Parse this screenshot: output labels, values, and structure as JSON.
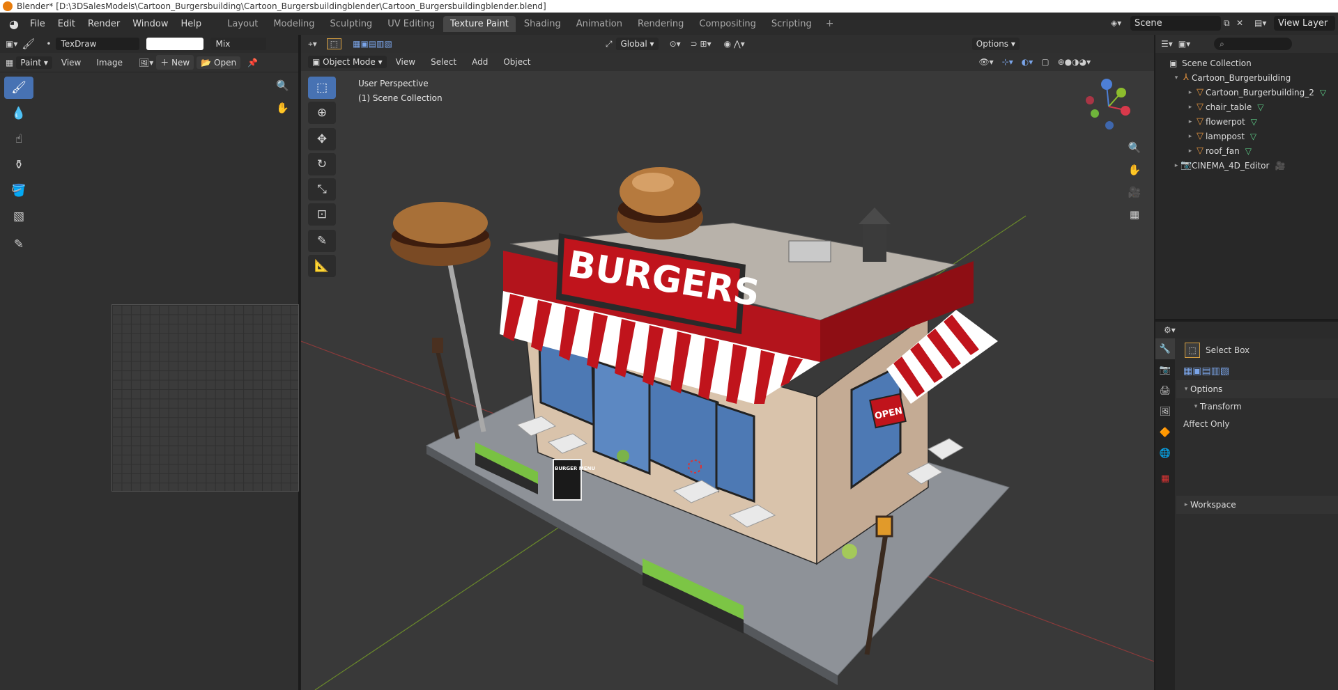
{
  "window": {
    "title": "Blender* [D:\\3DSalesModels\\Cartoon_Burgersbuilding\\Cartoon_Burgersbuildingblender\\Cartoon_Burgersbuildingblender.blend]"
  },
  "menu": [
    "File",
    "Edit",
    "Render",
    "Window",
    "Help"
  ],
  "workspaces": [
    "Layout",
    "Modeling",
    "Sculpting",
    "UV Editing",
    "Texture Paint",
    "Shading",
    "Animation",
    "Rendering",
    "Compositing",
    "Scripting"
  ],
  "active_workspace": "Texture Paint",
  "scene": {
    "name": "Scene",
    "view_layer": "View Layer"
  },
  "image_editor": {
    "brush_name": "TexDraw",
    "blend_mode": "Mix",
    "mode": "Paint",
    "menu": [
      "View",
      "Image"
    ],
    "new_label": "New",
    "open_label": "Open"
  },
  "viewport": {
    "orientation": "Global",
    "options_label": "Options",
    "mode": "Object Mode",
    "menu": [
      "View",
      "Select",
      "Add",
      "Object"
    ],
    "perspective": "User Perspective",
    "collection": "(1) Scene Collection",
    "sign_text": "BURGERS",
    "open_sign": "OPEN",
    "menu_board": "BURGER MENU"
  },
  "outliner": {
    "root": "Scene Collection",
    "items": [
      {
        "name": "Cartoon_Burgerbuilding",
        "level": 1
      },
      {
        "name": "Cartoon_Burgerbuilding_2",
        "level": 2
      },
      {
        "name": "chair_table",
        "level": 2
      },
      {
        "name": "flowerpot",
        "level": 2
      },
      {
        "name": "lamppost",
        "level": 2
      },
      {
        "name": "roof_fan",
        "level": 2
      },
      {
        "name": "CINEMA_4D_Editor",
        "level": 1
      }
    ]
  },
  "properties": {
    "tool_name": "Select Box",
    "options_label": "Options",
    "transform_label": "Transform",
    "affect_only": "Affect Only",
    "workspace_label": "Workspace"
  },
  "colors": {
    "accent": "#4772b3",
    "awning_red": "#c0141c",
    "mesh_green": "#5fd28a",
    "object_orange": "#e0913e"
  }
}
